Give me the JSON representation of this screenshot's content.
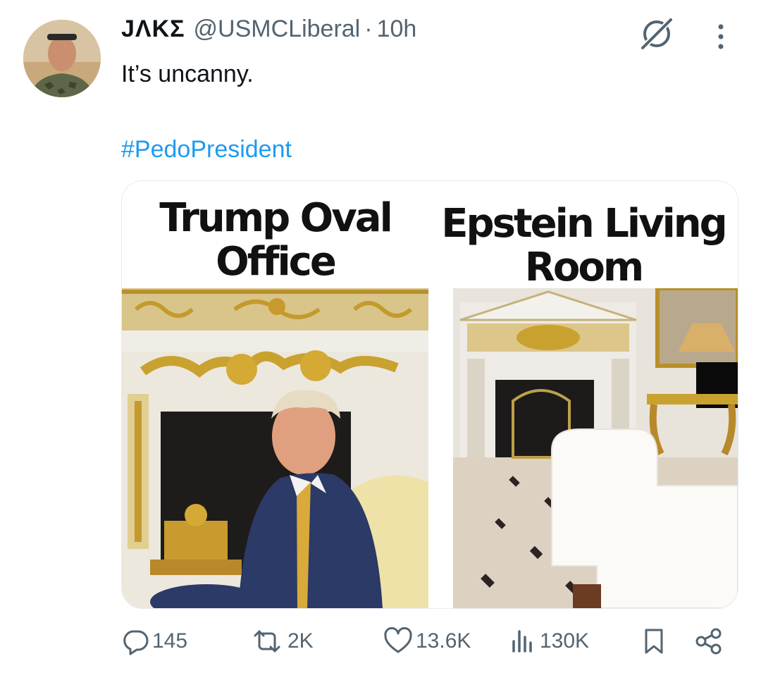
{
  "tweet": {
    "display_name": "JΛKΣ",
    "handle": "@USMCLiberal",
    "separator": "·",
    "time": "10h",
    "text": "It’s uncanny.",
    "hashtag": "#PedoPresident"
  },
  "media": {
    "left_title_line1": "Trump Oval",
    "left_title_line2": "Office",
    "right_title_line1": "Epstein Living",
    "right_title_line2": "Room"
  },
  "actions": {
    "replies": "145",
    "reposts": "2K",
    "likes": "13.6K",
    "views": "130K"
  },
  "icons": [
    "grok-icon",
    "more-icon",
    "reply-icon",
    "repost-icon",
    "like-icon",
    "views-icon",
    "bookmark-icon",
    "share-icon"
  ],
  "colors": {
    "link": "#1d9bf0",
    "secondary_text": "#536471",
    "primary_text": "#0f1419"
  }
}
